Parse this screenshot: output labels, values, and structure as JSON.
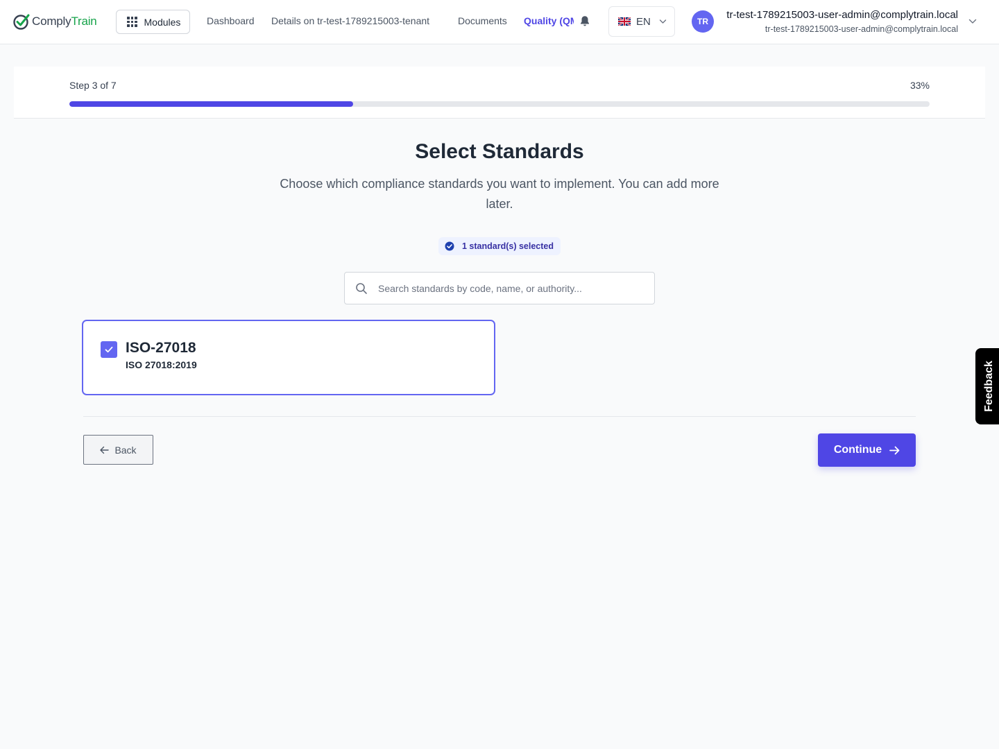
{
  "header": {
    "logo": {
      "part1": "Comply",
      "part2": "Train"
    },
    "modules_label": "Modules",
    "nav": [
      {
        "label": "Dashboard"
      },
      {
        "label": "Details on tr-test-1789215003-tenant"
      },
      {
        "label": "Documents"
      },
      {
        "label": "Quality (QM)"
      }
    ],
    "language": "EN",
    "user": {
      "initials": "TR",
      "name": "tr-test-1789215003-user-admin@complytrain.local",
      "email": "tr-test-1789215003-user-admin@complytrain.local"
    }
  },
  "progress": {
    "step_label": "Step 3 of 7",
    "percent_label": "33%",
    "fraction": 0.33
  },
  "main": {
    "title": "Select Standards",
    "subtitle": "Choose which compliance standards you want to implement. You can add more later.",
    "selected_badge": "1 standard(s) selected",
    "search": {
      "placeholder": "Search standards by code, name, or authority...",
      "value": ""
    },
    "standards": [
      {
        "code": "ISO-27018",
        "name": "ISO 27018:2019",
        "checked": true
      }
    ],
    "back_label": "Back",
    "continue_label": "Continue"
  },
  "feedback_label": "Feedback",
  "colors": {
    "accent": "#4f46e5",
    "accent_light": "#6366f1",
    "brand_green": "#16a34a"
  }
}
